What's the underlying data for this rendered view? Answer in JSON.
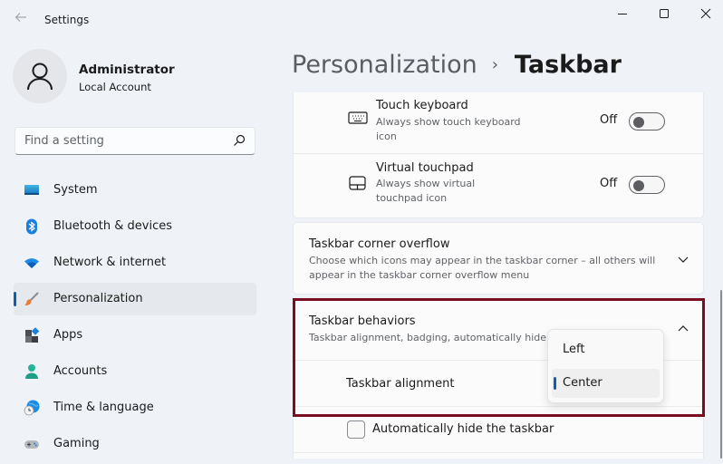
{
  "window": {
    "title": "Settings",
    "controls": {
      "minimize": "minimize",
      "maximize": "maximize",
      "close": "close"
    }
  },
  "profile": {
    "name": "Administrator",
    "account_type": "Local Account"
  },
  "search": {
    "placeholder": "Find a setting",
    "value": ""
  },
  "sidebar": {
    "items": [
      {
        "label": "System",
        "icon": "system-icon",
        "active": false
      },
      {
        "label": "Bluetooth & devices",
        "icon": "bluetooth-icon",
        "active": false
      },
      {
        "label": "Network & internet",
        "icon": "wifi-icon",
        "active": false
      },
      {
        "label": "Personalization",
        "icon": "brush-icon",
        "active": true
      },
      {
        "label": "Apps",
        "icon": "apps-icon",
        "active": false
      },
      {
        "label": "Accounts",
        "icon": "person-icon",
        "active": false
      },
      {
        "label": "Time & language",
        "icon": "clock-globe-icon",
        "active": false
      },
      {
        "label": "Gaming",
        "icon": "gamepad-icon",
        "active": false
      }
    ]
  },
  "breadcrumb": {
    "parent": "Personalization",
    "separator": "›",
    "current": "Taskbar"
  },
  "settings": {
    "touch_keyboard": {
      "title": "Touch keyboard",
      "description": "Always show touch keyboard icon",
      "state_label": "Off",
      "on": false
    },
    "virtual_touchpad": {
      "title": "Virtual touchpad",
      "description": "Always show virtual touchpad icon",
      "state_label": "Off",
      "on": false
    },
    "corner_overflow": {
      "title": "Taskbar corner overflow",
      "description": "Choose which icons may appear in the taskbar corner – all others will appear in the taskbar corner overflow menu",
      "expanded": false
    },
    "behaviors": {
      "title": "Taskbar behaviors",
      "description": "Taskbar alignment, badging, automatically hide, a",
      "expanded": true,
      "alignment_label": "Taskbar alignment",
      "alignment_options": [
        "Left",
        "Center"
      ],
      "alignment_selected": "Center",
      "auto_hide_label": "Automatically hide the taskbar",
      "auto_hide_checked": false
    }
  },
  "colors": {
    "accent": "#0f5fae",
    "highlight_border": "#7a0d22"
  }
}
